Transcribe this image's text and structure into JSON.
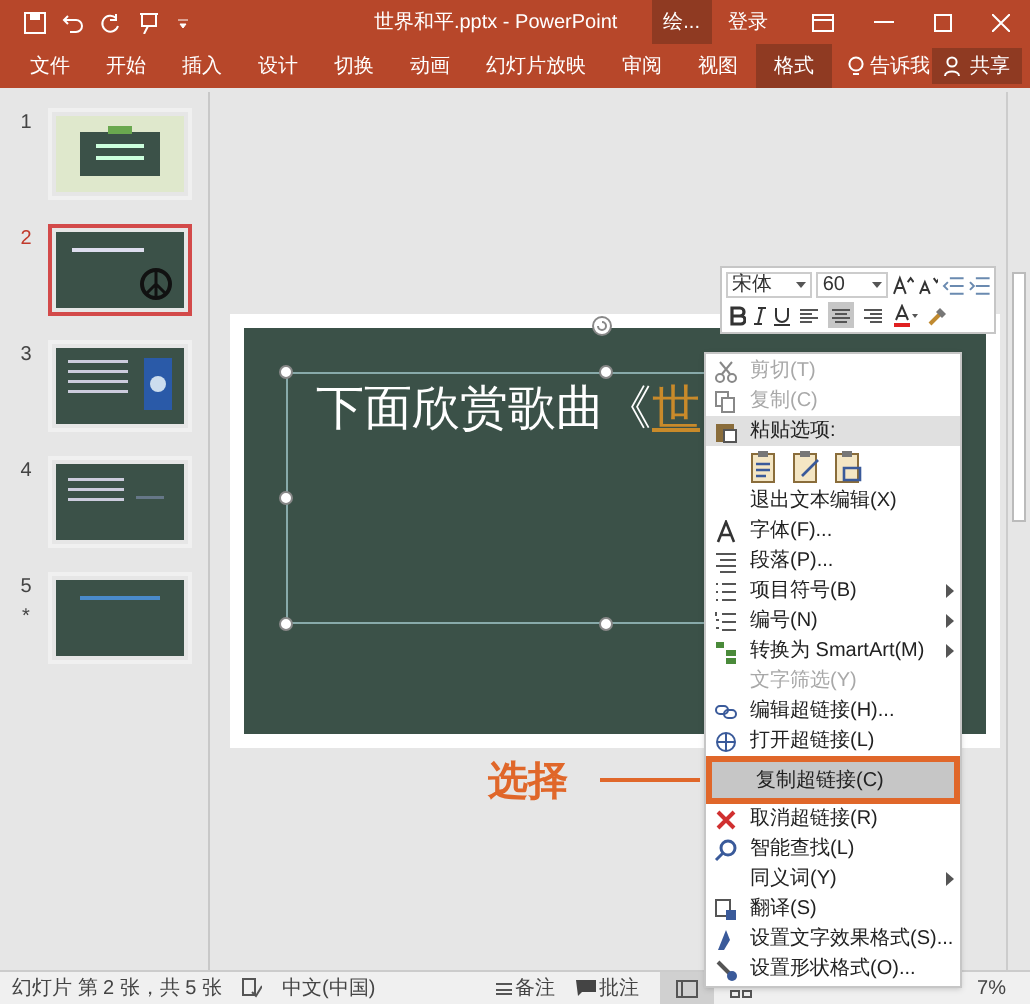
{
  "title_bar": {
    "title": "世界和平.pptx - PowerPoint",
    "context_tab": "绘...",
    "sign_in": "登录"
  },
  "ribbon_tabs": [
    {
      "label": "文件",
      "selected": false
    },
    {
      "label": "开始",
      "selected": false
    },
    {
      "label": "插入",
      "selected": false
    },
    {
      "label": "设计",
      "selected": false
    },
    {
      "label": "切换",
      "selected": false
    },
    {
      "label": "动画",
      "selected": false
    },
    {
      "label": "幻灯片放映",
      "selected": false
    },
    {
      "label": "审阅",
      "selected": false
    },
    {
      "label": "视图",
      "selected": false
    },
    {
      "label": "格式",
      "selected": true
    }
  ],
  "tell_me": "告诉我",
  "share": "共享",
  "thumbnails": [
    {
      "number": "1",
      "selected": false,
      "starred": false
    },
    {
      "number": "2",
      "selected": true,
      "starred": false
    },
    {
      "number": "3",
      "selected": false,
      "starred": false
    },
    {
      "number": "4",
      "selected": false,
      "starred": false
    },
    {
      "number": "5",
      "selected": false,
      "starred": true
    }
  ],
  "star_mark": "*",
  "slide": {
    "title_text": "下面欣赏歌曲《",
    "title_highlight": "世"
  },
  "mini_toolbar": {
    "font": "宋体",
    "size": "60",
    "align": [
      {
        "selected": false
      },
      {
        "selected": true
      },
      {
        "selected": false
      }
    ]
  },
  "context_menu": [
    {
      "kind": "item",
      "label": "剪切(T)",
      "disabled": true,
      "selected": false,
      "submenu": false
    },
    {
      "kind": "item",
      "label": "复制(C)",
      "disabled": true,
      "selected": false,
      "submenu": false
    },
    {
      "kind": "header",
      "label": "粘贴选项:"
    },
    {
      "kind": "paste_options"
    },
    {
      "kind": "item",
      "label": "退出文本编辑(X)",
      "disabled": false,
      "selected": false,
      "submenu": false
    },
    {
      "kind": "item",
      "label": "字体(F)...",
      "disabled": false,
      "selected": false,
      "submenu": false
    },
    {
      "kind": "item",
      "label": "段落(P)...",
      "disabled": false,
      "selected": false,
      "submenu": false
    },
    {
      "kind": "item",
      "label": "项目符号(B)",
      "disabled": false,
      "selected": false,
      "submenu": true
    },
    {
      "kind": "item",
      "label": "编号(N)",
      "disabled": false,
      "selected": false,
      "submenu": true
    },
    {
      "kind": "item",
      "label": "转换为 SmartArt(M)",
      "disabled": false,
      "selected": false,
      "submenu": true
    },
    {
      "kind": "item",
      "label": "文字筛选(Y)",
      "disabled": true,
      "selected": false,
      "submenu": false
    },
    {
      "kind": "item",
      "label": "编辑超链接(H)...",
      "disabled": false,
      "selected": false,
      "submenu": false
    },
    {
      "kind": "item",
      "label": "打开超链接(L)",
      "disabled": false,
      "selected": false,
      "submenu": false
    },
    {
      "kind": "item",
      "label": "复制超链接(C)",
      "disabled": false,
      "selected": true,
      "submenu": false
    },
    {
      "kind": "item",
      "label": "取消超链接(R)",
      "disabled": false,
      "selected": false,
      "submenu": false
    },
    {
      "kind": "item",
      "label": "智能查找(L)",
      "disabled": false,
      "selected": false,
      "submenu": false
    },
    {
      "kind": "item",
      "label": "同义词(Y)",
      "disabled": false,
      "selected": false,
      "submenu": true
    },
    {
      "kind": "item",
      "label": "翻译(S)",
      "disabled": false,
      "selected": false,
      "submenu": false
    },
    {
      "kind": "item",
      "label": "设置文字效果格式(S)...",
      "disabled": false,
      "selected": false,
      "submenu": false
    },
    {
      "kind": "item",
      "label": "设置形状格式(O)...",
      "disabled": false,
      "selected": false,
      "submenu": false
    }
  ],
  "annotation": "选择",
  "status_bar": {
    "slide_info": "幻灯片 第 2 张，共 5 张",
    "language": "中文(中国)",
    "notes": "备注",
    "comments": "批注",
    "zoom": "7%"
  }
}
